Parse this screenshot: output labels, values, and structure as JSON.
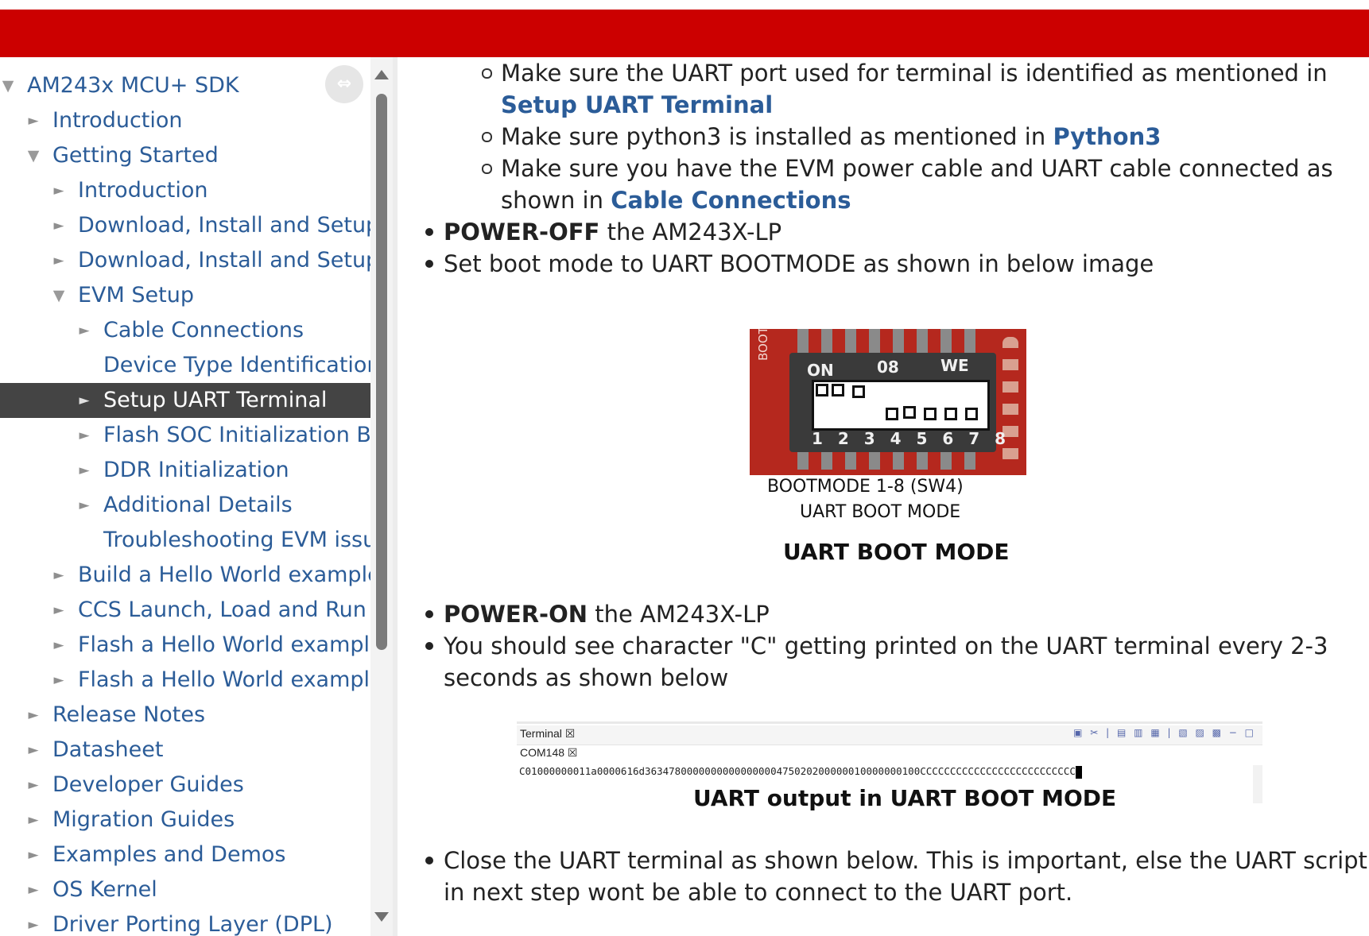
{
  "sidebar": {
    "tree": [
      {
        "label": "AM243x MCU+ SDK",
        "arrow": "down",
        "level": 0
      },
      {
        "label": "Introduction",
        "arrow": "right",
        "level": 1
      },
      {
        "label": "Getting Started",
        "arrow": "down",
        "level": 1
      },
      {
        "label": "Introduction",
        "arrow": "right",
        "level": 2
      },
      {
        "label": "Download, Install and Setup S",
        "arrow": "right",
        "level": 2
      },
      {
        "label": "Download, Install and Setup C",
        "arrow": "right",
        "level": 2
      },
      {
        "label": "EVM Setup",
        "arrow": "down",
        "level": 2
      },
      {
        "label": "Cable Connections",
        "arrow": "right",
        "level": 3
      },
      {
        "label": "Device Type Identification",
        "arrow": "none",
        "level": 3
      },
      {
        "label": "Setup UART Terminal",
        "arrow": "right",
        "level": 3,
        "selected": true
      },
      {
        "label": "Flash SOC Initialization Bina",
        "arrow": "right",
        "level": 3
      },
      {
        "label": "DDR Initialization",
        "arrow": "right",
        "level": 3
      },
      {
        "label": "Additional Details",
        "arrow": "right",
        "level": 3
      },
      {
        "label": "Troubleshooting EVM issue",
        "arrow": "none",
        "level": 3
      },
      {
        "label": "Build a Hello World example",
        "arrow": "right",
        "level": 2
      },
      {
        "label": "CCS Launch, Load and Run",
        "arrow": "right",
        "level": 2
      },
      {
        "label": "Flash a Hello World example",
        "arrow": "right",
        "level": 2
      },
      {
        "label": "Flash a Hello World example u",
        "arrow": "right",
        "level": 2
      },
      {
        "label": "Release Notes",
        "arrow": "right",
        "level": 1
      },
      {
        "label": "Datasheet",
        "arrow": "right",
        "level": 1
      },
      {
        "label": "Developer Guides",
        "arrow": "right",
        "level": 1
      },
      {
        "label": "Migration Guides",
        "arrow": "right",
        "level": 1
      },
      {
        "label": "Examples and Demos",
        "arrow": "right",
        "level": 1
      },
      {
        "label": "OS Kernel",
        "arrow": "right",
        "level": 1
      },
      {
        "label": "Driver Porting Layer (DPL)",
        "arrow": "right",
        "level": 1
      }
    ],
    "collapse_icon": "⇔"
  },
  "content": {
    "sub1_a": "Make sure the UART port used for terminal is identified as mentioned in",
    "sub1_link": "Setup UART Terminal",
    "sub2_a": "Make sure python3 is installed as mentioned in ",
    "sub2_link": "Python3",
    "sub3_a": "Make sure you have the EVM power cable and UART cable connected as",
    "sub3_b": "shown in ",
    "sub3_link": "Cable Connections",
    "b1_bold": "POWER-OFF",
    "b1_rest": " the AM243X-LP",
    "b2": "Set boot mode to UART BOOTMODE as shown in below image",
    "fig1_on": "ON",
    "fig1_08": "08",
    "fig1_we": "WE",
    "fig1_nums": "1 2 3 4 5 6 7 8",
    "fig1_side": "BOOT MODE SEL",
    "fig1_cap1": "BOOTMODE 1-8 (SW4)",
    "fig1_cap2": "UART BOOT MODE",
    "caption1": "UART BOOT MODE",
    "b3_bold": "POWER-ON",
    "b3_rest": " the AM243X-LP",
    "b4_a": "You should see character \"C\" getting printed on the UART terminal every 2-3",
    "b4_b": "seconds as shown below",
    "term_tab": "Terminal ☒",
    "term_tab2": "COM148 ☒",
    "term_icons": "▣ ✂ | ▤ ▥ ▦ | ▧ ▨ ▩ − □",
    "term_output": "C01000000011a0000616d3634780000000000000000475020200000010000000100CCCCCCCCCCCCCCCCCCCCCCCCCC",
    "caption2": "UART output in UART BOOT MODE",
    "b5_a": "Close the UART terminal as shown below. This is important, else the UART script",
    "b5_b": "in next step wont be able to connect to the UART port."
  }
}
